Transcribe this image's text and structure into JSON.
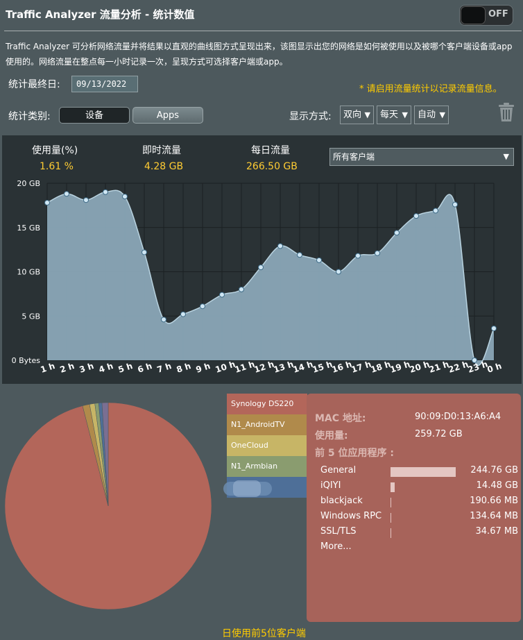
{
  "header": {
    "title": "Traffic Analyzer 流量分析 - 统计数值",
    "toggle_label": "OFF"
  },
  "description": "Traffic Analyzer 可分析网络流量并将结果以直观的曲线图方式呈现出来，该图显示出您的网络是如何被使用以及被哪个客户端设备或app使用的。网络流量在整点每一小时记录一次，呈现方式可选择客户端或app。",
  "controls": {
    "end_date_label": "统计最终日:",
    "end_date_value": "09/13/2022",
    "notice": "* 请启用流量统计以记录流量信息。",
    "category_label": "统计类别:",
    "category_options": [
      "设备",
      "Apps"
    ],
    "display_label": "显示方式:",
    "direction": "双向",
    "period": "每天",
    "scale": "自动",
    "trash_icon": "trash-icon"
  },
  "stats": {
    "usage_label": "使用量(%)",
    "usage_value": "1.61 %",
    "realtime_label": "即时流量",
    "realtime_value": "4.28 GB",
    "daily_label": "每日流量",
    "daily_value": "266.50 GB",
    "client_filter": "所有客户端"
  },
  "chart_data": {
    "type": "area",
    "title": "",
    "xlabel": "",
    "ylabel": "",
    "x": [
      "1 h",
      "2 h",
      "3 h",
      "4 h",
      "5 h",
      "6 h",
      "7 h",
      "8 h",
      "9 h",
      "10 h",
      "11 h",
      "12 h",
      "13 h",
      "14 h",
      "15 h",
      "16 h",
      "17 h",
      "18 h",
      "19 h",
      "20 h",
      "21 h",
      "22 h",
      "23 h",
      "0 h"
    ],
    "values": [
      17.8,
      18.8,
      18.1,
      19.0,
      18.5,
      12.2,
      4.6,
      5.2,
      6.1,
      7.4,
      8.0,
      10.5,
      12.9,
      11.9,
      11.3,
      10.0,
      11.8,
      12.1,
      14.4,
      16.3,
      16.9,
      17.6,
      0.0,
      3.6
    ],
    "unit": "GB",
    "yticks": [
      "0 Bytes",
      "5 GB",
      "10 GB",
      "15 GB",
      "20 GB"
    ],
    "ylim": [
      0,
      20
    ],
    "grid": true,
    "fill_color": "#8aa7b7",
    "line_color": "#b9d3e0"
  },
  "pie": {
    "title": "日使用前5位客户端",
    "slices": [
      {
        "name": "Synology DS220",
        "value": 259.72,
        "color": "#b3665a"
      },
      {
        "name": "N1_AndroidTV",
        "value": 3.0,
        "color": "#b08a4b"
      },
      {
        "name": "OneCloud",
        "value": 2.2,
        "color": "#c7b566"
      },
      {
        "name": "N1_Armbian",
        "value": 1.6,
        "color": "#8a9c6f"
      },
      {
        "name": "",
        "value": 1.4,
        "color": "#4e6f98"
      },
      {
        "name": "",
        "value": 2.6,
        "color": "#7a6f92"
      }
    ]
  },
  "client_info": {
    "mac_label": "MAC 地址:",
    "mac_value": "90:09:D0:13:A6:A4",
    "usage_label": "使用量:",
    "usage_value": "259.72 GB",
    "top_apps_label": "前 5 位应用程序 :",
    "apps": [
      {
        "name": "General",
        "size": "244.76 GB",
        "fraction": 1.0
      },
      {
        "name": "iQIYI",
        "size": "14.48 GB",
        "fraction": 0.059
      },
      {
        "name": "blackjack",
        "size": "190.66 MB",
        "fraction": 0.001
      },
      {
        "name": "Windows RPC",
        "size": "134.64 MB",
        "fraction": 0.001
      },
      {
        "name": "SSL/TLS",
        "size": "34.67 MB",
        "fraction": 0.0003
      }
    ],
    "more_label": "More..."
  }
}
